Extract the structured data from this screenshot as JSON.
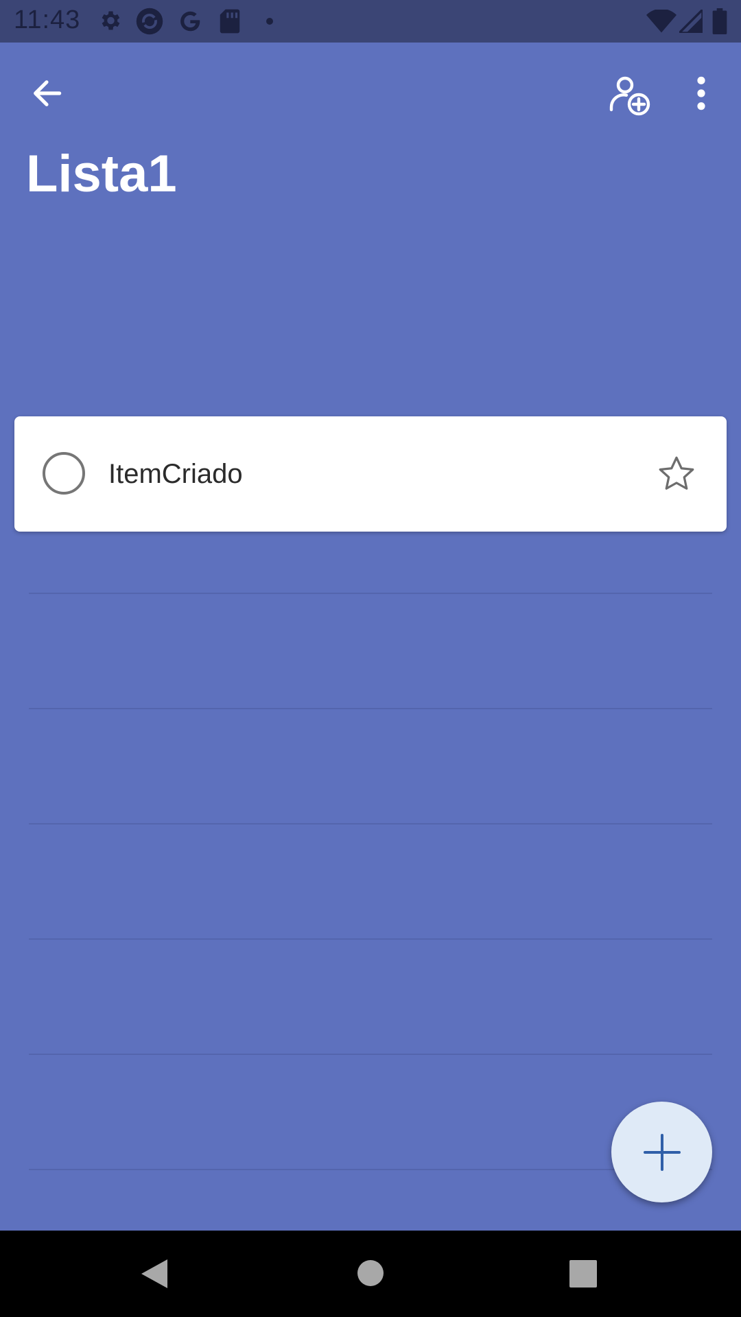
{
  "status_bar": {
    "time": "11:43",
    "icons": [
      "settings-icon",
      "sync-icon",
      "google-icon",
      "sd-card-icon",
      "dot-icon",
      "wifi-icon",
      "signal-icon",
      "battery-icon"
    ]
  },
  "app_bar": {
    "back_icon": "arrow-left-icon",
    "share_icon": "add-person-icon",
    "more_icon": "more-vert-icon"
  },
  "list": {
    "title": "Lista1",
    "tasks": [
      {
        "title": "ItemCriado",
        "completed": false,
        "starred": false
      }
    ]
  },
  "fab": {
    "icon": "plus-icon"
  },
  "colors": {
    "background": "#5e71be",
    "status_bar": "#3b4575",
    "card": "#ffffff",
    "fab": "#dfeaf7",
    "fab_icon": "#2f5fa8",
    "nav_bar": "#000000"
  },
  "nav_bar": {
    "buttons": [
      "back-triangle-icon",
      "home-circle-icon",
      "recents-square-icon"
    ]
  }
}
